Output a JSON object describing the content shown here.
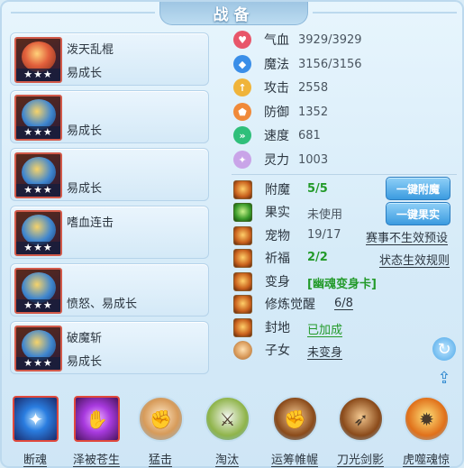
{
  "title": "战备",
  "equipment": [
    {
      "name": "泼天乱棍",
      "desc": "易成长",
      "stars": "★★★",
      "icon": "club-icon"
    },
    {
      "name": "",
      "desc": "易成长",
      "stars": "★★★",
      "icon": "golden-armor-icon"
    },
    {
      "name": "",
      "desc": "易成长",
      "stars": "★★★",
      "icon": "golden-mask-icon"
    },
    {
      "name": "嗜血连击",
      "desc": "",
      "stars": "★★★",
      "icon": "blue-crown-icon"
    },
    {
      "name": "",
      "desc": "愤怒、易成长",
      "stars": "★★★",
      "icon": "blue-ring-icon"
    },
    {
      "name": "破魔斩",
      "desc": "易成长",
      "stars": "★★★",
      "icon": "golden-ornament-icon"
    }
  ],
  "stats": [
    {
      "label": "气血",
      "value": "3929/3929",
      "icon": "heart-icon",
      "color": "#e8566a"
    },
    {
      "label": "魔法",
      "value": "3156/3156",
      "icon": "mana-diamond-icon",
      "color": "#3a8ee8"
    },
    {
      "label": "攻击",
      "value": "2558",
      "icon": "attack-icon",
      "color": "#f0b43a"
    },
    {
      "label": "防御",
      "value": "1352",
      "icon": "shield-icon",
      "color": "#f08a3a"
    },
    {
      "label": "速度",
      "value": "681",
      "icon": "speed-icon",
      "color": "#2fbf7a"
    },
    {
      "label": "灵力",
      "value": "1003",
      "icon": "spirit-icon",
      "color": "#c9a4e8"
    }
  ],
  "properties": {
    "enchant": {
      "label": "附魔",
      "value": "5/5"
    },
    "fruit": {
      "label": "果实",
      "value": "未使用"
    },
    "pet": {
      "label": "宠物",
      "value": "19/17",
      "link": "赛事不生效预设"
    },
    "blessing": {
      "label": "祈福",
      "value": "2/2",
      "link": "状态生效规则"
    },
    "transform": {
      "label": "变身",
      "value": "[幽魂变身卡]"
    },
    "awaken": {
      "label": "修炼觉醒",
      "value": "6/8"
    },
    "fief": {
      "label": "封地",
      "value": "已加成"
    },
    "children": {
      "label": "子女",
      "value": "未变身"
    }
  },
  "buttons": {
    "one_click_enchant": "一键附魔",
    "one_click_fruit": "一键果实"
  },
  "skills": [
    {
      "label": "断魂",
      "icon": "blue-orb-icon"
    },
    {
      "label": "泽被苍生",
      "icon": "purple-palm-icon"
    },
    {
      "label": "猛击",
      "icon": "fist-icon"
    },
    {
      "label": "淘汰",
      "icon": "sword-icon"
    },
    {
      "label": "运筹帷幄",
      "icon": "fist-power-icon"
    },
    {
      "label": "刀光剑影",
      "icon": "blade-icon"
    },
    {
      "label": "虎噬魂惊",
      "icon": "fire-tiger-icon"
    }
  ]
}
